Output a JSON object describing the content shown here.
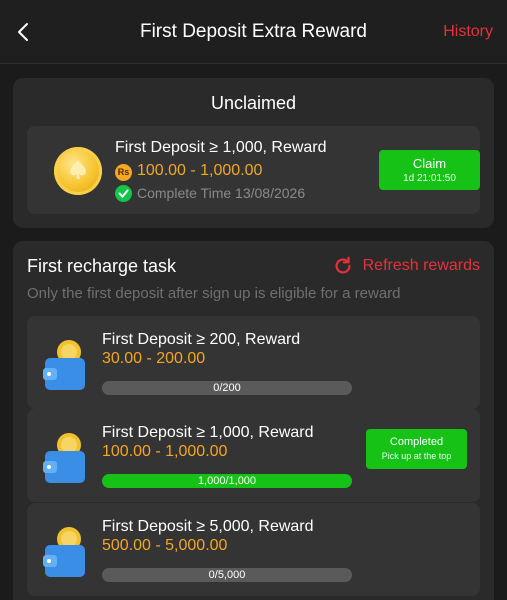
{
  "header": {
    "title": "First Deposit Extra Reward",
    "history_label": "History"
  },
  "unclaimed": {
    "title": "Unclaimed",
    "item": {
      "title": "First Deposit ≥ 1,000, Reward",
      "currency_symbol": "Rs",
      "amount": "100.00 - 1,000.00",
      "complete_time": "Complete Time 13/08/2026",
      "claim_label": "Claim",
      "countdown": "1d 21:01:50"
    }
  },
  "tasks": {
    "title": "First recharge task",
    "refresh_label": "Refresh rewards",
    "note": "Only the first deposit after sign up is eligible for a reward",
    "items": [
      {
        "title": "First Deposit ≥ 200, Reward",
        "amount": "30.00 - 200.00",
        "progress_text": "0/200",
        "progress": 0
      },
      {
        "title": "First Deposit ≥ 1,000, Reward",
        "amount": "100.00 - 1,000.00",
        "progress_text": "1,000/1,000",
        "progress": 1,
        "status_label": "Completed",
        "status_sub": "Pick up at the top"
      },
      {
        "title": "First Deposit ≥ 5,000, Reward",
        "amount": "500.00 - 5,000.00",
        "progress_text": "0/5,000",
        "progress": 0
      }
    ]
  },
  "colors": {
    "accent_red": "#e8303a",
    "gold": "#f5a623",
    "green": "#16c216"
  },
  "icons": [
    "back-arrow-icon",
    "coin-icon",
    "rupee-icon",
    "check-circle-icon",
    "refresh-icon",
    "wallet-coin-icon"
  ]
}
